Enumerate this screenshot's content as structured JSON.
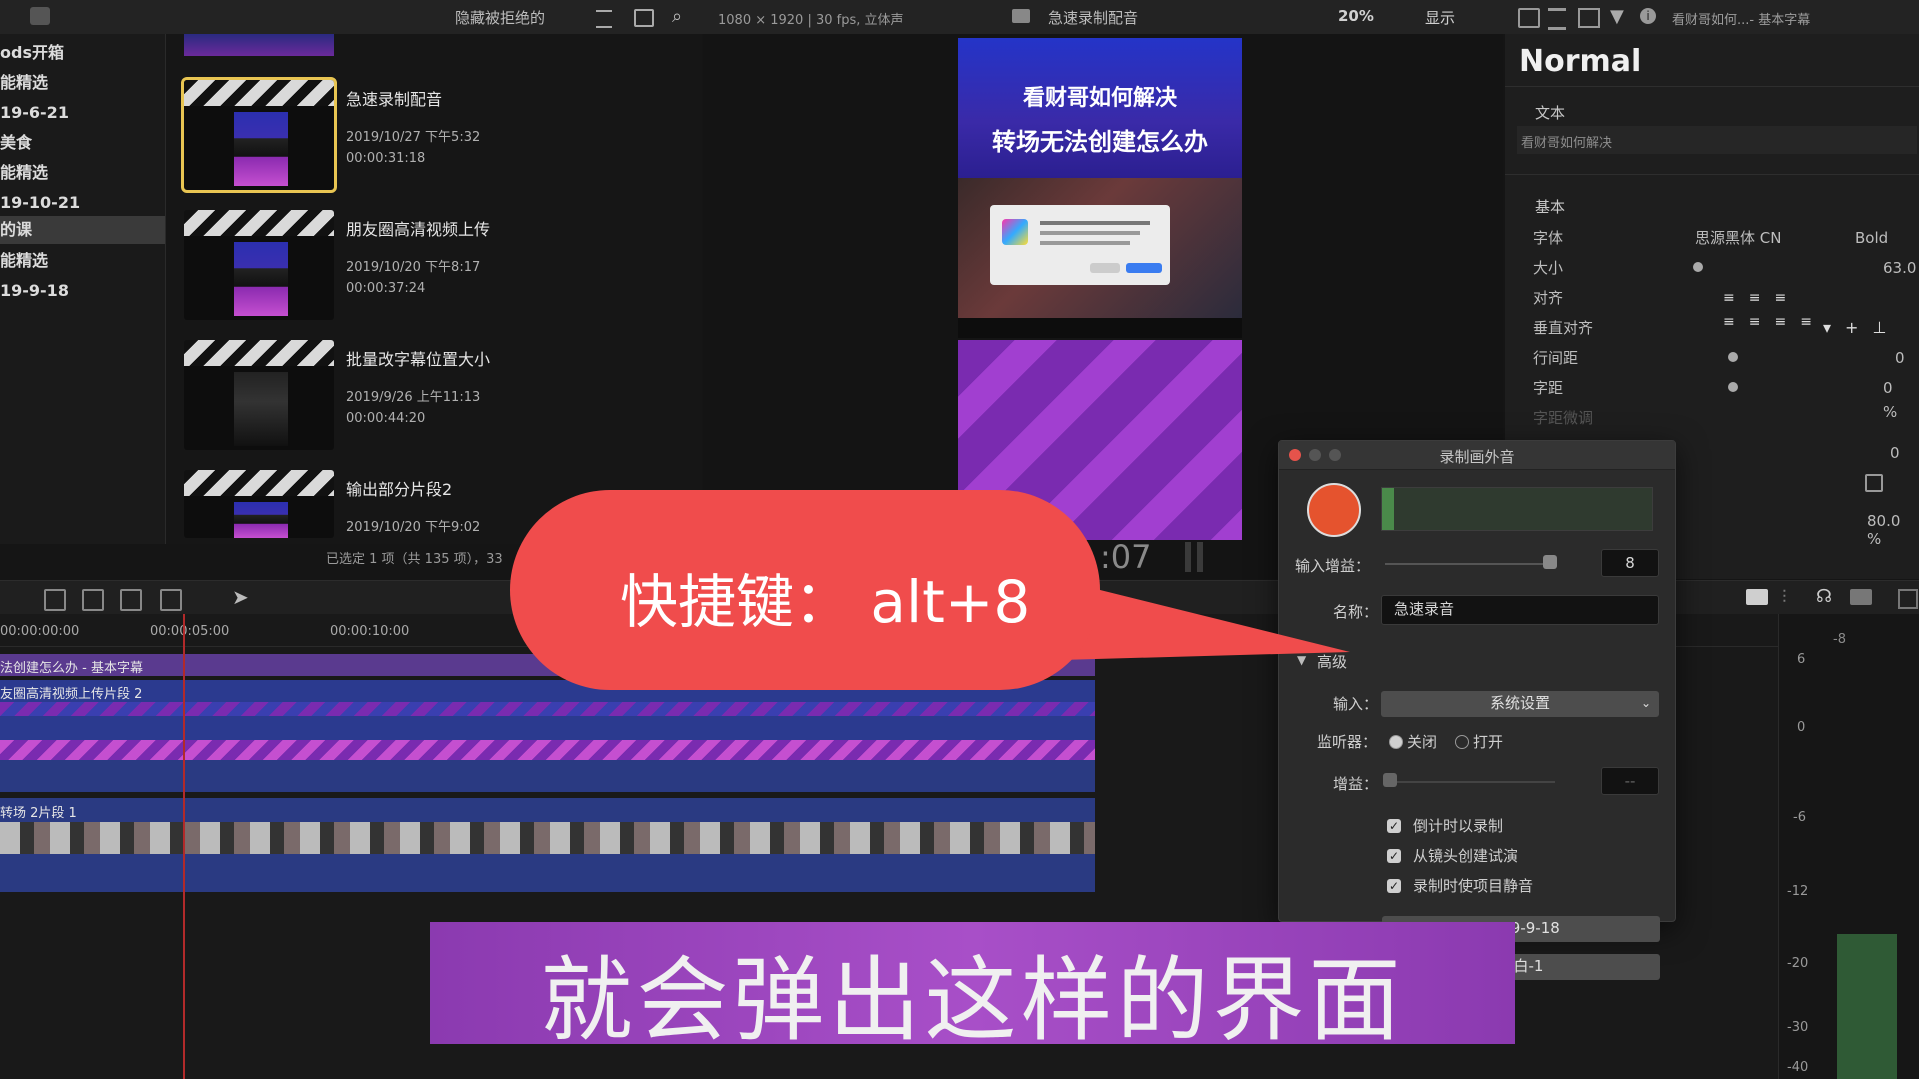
{
  "topbar": {
    "hide_rejected": "隐藏被拒绝的",
    "format_info": "1080 × 1920 | 30 fps, 立体声",
    "project_title": "急速录制配音",
    "zoom": "20%",
    "display": "显示",
    "inspector_title": "看财哥如何...- 基本字幕"
  },
  "sidebar": {
    "items": [
      {
        "label": "ods开箱"
      },
      {
        "label": "能精选"
      },
      {
        "label": "19-6-21"
      },
      {
        "label": "美食"
      },
      {
        "label": "能精选"
      },
      {
        "label": "19-10-21"
      },
      {
        "label": "的课"
      },
      {
        "label": "能精选"
      },
      {
        "label": "19-9-18"
      }
    ]
  },
  "browser": {
    "clips": [
      {
        "title": "急速录制配音",
        "date": "2019/10/27 下午5:32",
        "duration": "00:00:31:18"
      },
      {
        "title": "朋友圈高清视频上传",
        "date": "2019/10/20 下午8:17",
        "duration": "00:00:37:24"
      },
      {
        "title": "批量改字幕位置大小",
        "date": "2019/9/26 上午11:13",
        "duration": "00:00:44:20"
      },
      {
        "title": "输出部分片段2",
        "date": "2019/10/20 下午9:02",
        "duration": ""
      }
    ],
    "status": "已选定 1 项（共 135 项），33"
  },
  "viewer": {
    "video_title_line1": "看财哥如何解决",
    "video_title_line2": "转场无法创建怎么办",
    "timecode": ":07"
  },
  "inspector": {
    "style_name": "Normal",
    "text_section": "文本",
    "text_value": "看财哥如何解决",
    "basic_section": "基本",
    "rows": [
      {
        "label": "字体",
        "value": "思源黑体 CN",
        "extra": "Bold"
      },
      {
        "label": "大小",
        "value": "63.0"
      },
      {
        "label": "对齐",
        "value": ""
      },
      {
        "label": "垂直对齐",
        "value": ""
      },
      {
        "label": "行间距",
        "value": "0"
      },
      {
        "label": "字距",
        "value": "0 %"
      },
      {
        "label": "字距微调",
        "value": ""
      }
    ],
    "extra_values": [
      "0",
      "80.0 %"
    ]
  },
  "timeline": {
    "ticks": [
      "00:00:00:00",
      "00:00:05:00",
      "00:00:10:00"
    ],
    "track_labels": [
      "法创建怎么办 - 基本字幕",
      "友圈高清视频上传片段 2",
      "转场 2片段 1"
    ]
  },
  "audio_meter": {
    "labels": [
      "-8",
      "6",
      "0",
      "-6",
      "-12",
      "-20",
      "-30",
      "-40"
    ]
  },
  "record_dialog": {
    "title": "录制画外音",
    "input_gain_label": "输入增益：",
    "input_gain_value": "8",
    "name_label": "名称：",
    "name_value": "急速录音",
    "advanced_label": "高级",
    "input_label": "输入：",
    "input_value": "系统设置",
    "monitor_label": "监听器：",
    "monitor_off": "关闭",
    "monitor_on": "打开",
    "gain_label": "增益：",
    "gain_value": "--",
    "checkboxes": [
      {
        "label": "倒计时以录制"
      },
      {
        "label": "从镜头创建试演"
      },
      {
        "label": "录制时使项目静音"
      }
    ],
    "event_value": "2019-9-18",
    "role_value": "对白-1"
  },
  "callout": {
    "text": "快捷键： alt+8",
    "color": "#f04c4c"
  },
  "subtitle": {
    "text": "就会弹出这样的界面"
  }
}
